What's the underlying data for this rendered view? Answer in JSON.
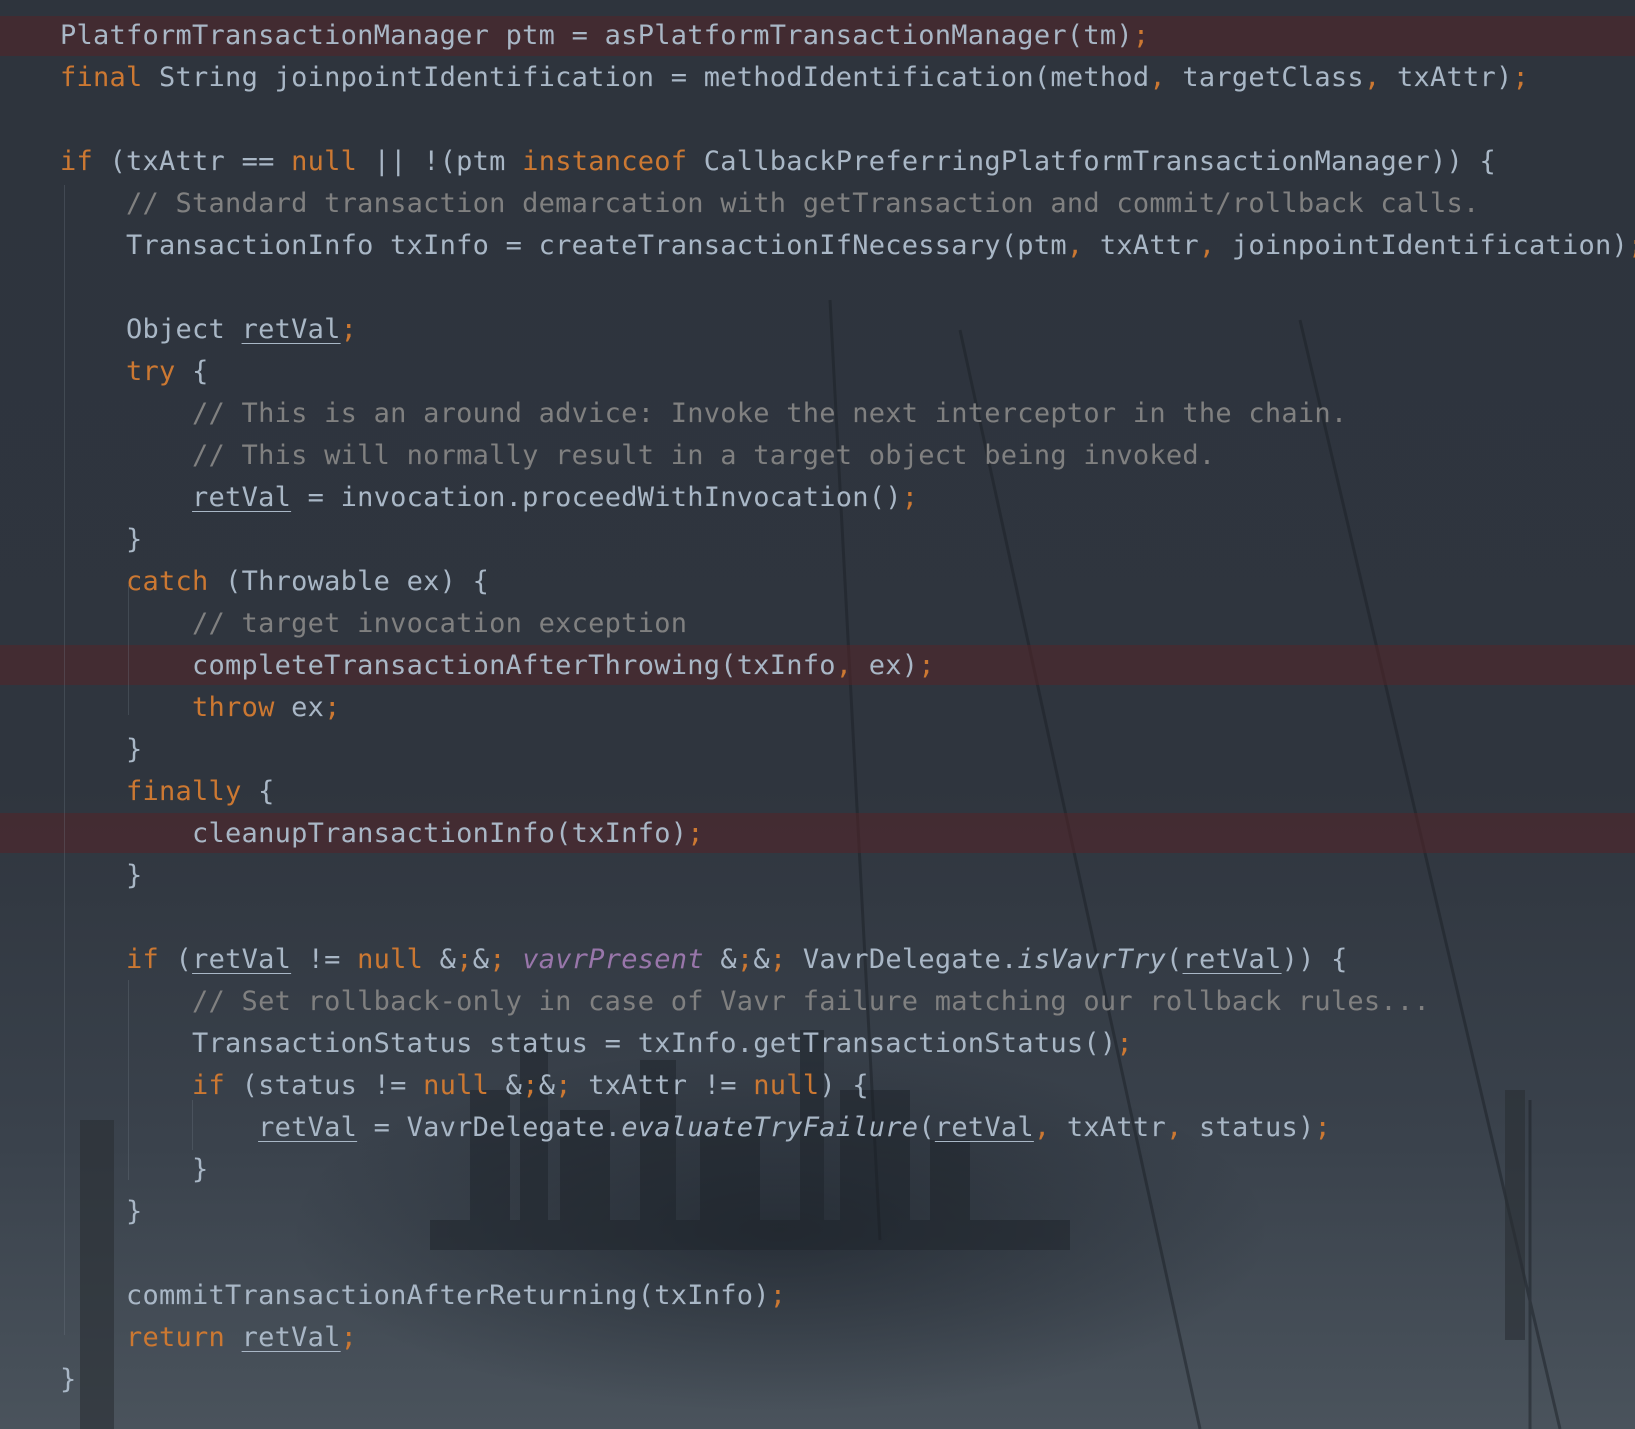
{
  "lines": [
    "PlatformTransactionManager ptm = asPlatformTransactionManager(tm);",
    "final String joinpointIdentification = methodIdentification(method, targetClass, txAttr);",
    "",
    "if (txAttr == null || !(ptm instanceof CallbackPreferringPlatformTransactionManager)) {",
    "    // Standard transaction demarcation with getTransaction and commit/rollback calls.",
    "    TransactionInfo txInfo = createTransactionIfNecessary(ptm, txAttr, joinpointIdentification);",
    "",
    "    Object retVal;",
    "    try {",
    "        // This is an around advice: Invoke the next interceptor in the chain.",
    "        // This will normally result in a target object being invoked.",
    "        retVal = invocation.proceedWithInvocation();",
    "    }",
    "    catch (Throwable ex) {",
    "        // target invocation exception",
    "        completeTransactionAfterThrowing(txInfo, ex);",
    "        throw ex;",
    "    }",
    "    finally {",
    "        cleanupTransactionInfo(txInfo);",
    "    }",
    "",
    "    if (retVal != null && vavrPresent && VavrDelegate.isVavrTry(retVal)) {",
    "        // Set rollback-only in case of Vavr failure matching our rollback rules...",
    "        TransactionStatus status = txInfo.getTransactionStatus();",
    "        if (status != null && txAttr != null) {",
    "            retVal = VavrDelegate.evaluateTryFailure(retVal, txAttr, status);",
    "        }",
    "    }",
    "",
    "    commitTransactionAfterReturning(txInfo);",
    "    return retVal;",
    "}"
  ],
  "highlighted_lines": [
    0,
    15,
    19
  ],
  "colors": {
    "text": "#a9b7c6",
    "keyword": "#cc7832",
    "comment": "#808080",
    "static_field": "#9876aa",
    "breakpoint_line": "#542428"
  }
}
